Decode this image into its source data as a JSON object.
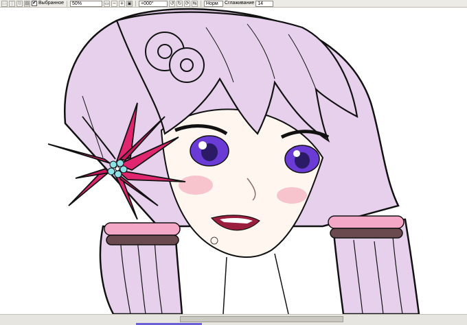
{
  "toolbar": {
    "favorites_checked": true,
    "favorites_label": "Выбранное",
    "zoom_value": "50%",
    "rotation_value": "+000°",
    "blend_mode": "Норм",
    "smoothing_label": "Сглаживание",
    "smoothing_value": "14",
    "icons": [
      "new-file-icon",
      "open-file-icon",
      "copy-icon",
      "paste-icon",
      "zoom-out-icon",
      "minus-icon",
      "plus-icon",
      "fit-icon",
      "rotate-left-icon",
      "rotate-right-icon",
      "reset-rotation-icon",
      "flip-icon"
    ]
  },
  "canvas": {
    "subject": "anime-girl-illustration",
    "colors": {
      "hair": "#e6d0ec",
      "skin": "#fff6f0",
      "flower": "#e0266e",
      "eyes": "#6b3bd6",
      "bands": "#f4a8c8",
      "band_dark": "#6a4a4e",
      "line": "#111111"
    }
  },
  "statusbar": {
    "scroll_position": 0.55
  }
}
